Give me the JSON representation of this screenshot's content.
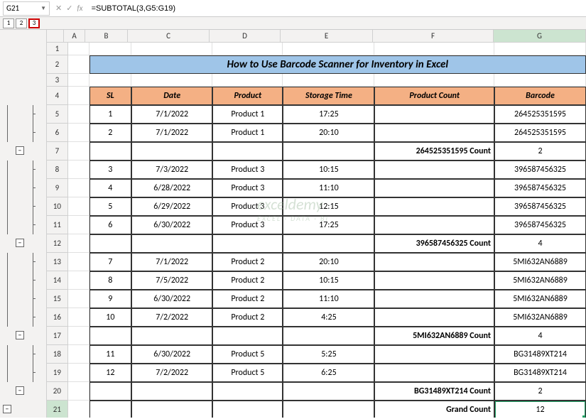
{
  "nameBox": "G21",
  "formula": "=SUBTOTAL(3,G5:G19)",
  "outlineLevels": [
    "1",
    "2",
    "3"
  ],
  "outlineSelected": "3",
  "colHeaders": [
    "A",
    "B",
    "C",
    "D",
    "E",
    "F",
    "G"
  ],
  "title": "How to Use Barcode Scanner for Inventory in Excel",
  "headers": {
    "sl": "SL",
    "date": "Date",
    "product": "Product",
    "storage": "Storage Time",
    "count": "Product Count",
    "barcode": "Barcode"
  },
  "rows": [
    {
      "num": 1,
      "low": true,
      "cells": [
        "",
        "",
        "",
        "",
        "",
        ""
      ]
    },
    {
      "num": 2,
      "title": true
    },
    {
      "num": 3,
      "low": true,
      "cells": [
        "",
        "",
        "",
        "",
        "",
        ""
      ]
    },
    {
      "num": 4,
      "header": true
    },
    {
      "num": 5,
      "ol": {
        "line": 2,
        "dot": true
      },
      "data": [
        "1",
        "7/1/2022",
        "Product 1",
        "17:25",
        "",
        "264525351595"
      ]
    },
    {
      "num": 6,
      "ol": {
        "line": 2,
        "dot": true
      },
      "data": [
        "2",
        "7/1/2022",
        "Product 1",
        "20:10",
        "",
        "264525351595"
      ]
    },
    {
      "num": 7,
      "ol": {
        "toggle": 1
      },
      "data": [
        "",
        "",
        "",
        "",
        "264525351595 Count",
        "2"
      ],
      "countRow": true
    },
    {
      "num": 8,
      "ol": {
        "line": 2,
        "dot": true
      },
      "data": [
        "3",
        "7/3/2022",
        "Product 3",
        "10:15",
        "",
        "396587456325"
      ]
    },
    {
      "num": 9,
      "ol": {
        "line": 2,
        "dot": true
      },
      "data": [
        "4",
        "6/28/2022",
        "Product 3",
        "11:10",
        "",
        "396587456325"
      ]
    },
    {
      "num": 10,
      "ol": {
        "line": 2,
        "dot": true
      },
      "data": [
        "5",
        "6/29/2022",
        "Product 3",
        "12:15",
        "",
        "396587456325"
      ]
    },
    {
      "num": 11,
      "ol": {
        "line": 2,
        "dot": true
      },
      "data": [
        "6",
        "6/30/2022",
        "Product 3",
        "17:25",
        "",
        "396587456325"
      ]
    },
    {
      "num": 12,
      "ol": {
        "toggle": 1
      },
      "data": [
        "",
        "",
        "",
        "",
        "396587456325 Count",
        "4"
      ],
      "countRow": true
    },
    {
      "num": 13,
      "ol": {
        "line": 2,
        "dot": true
      },
      "data": [
        "7",
        "7/1/2022",
        "Product 2",
        "20:10",
        "",
        "5MI632AN6889"
      ]
    },
    {
      "num": 14,
      "ol": {
        "line": 2,
        "dot": true
      },
      "data": [
        "8",
        "7/5/2022",
        "Product 2",
        "10:15",
        "",
        "5MI632AN6889"
      ]
    },
    {
      "num": 15,
      "ol": {
        "line": 2,
        "dot": true
      },
      "data": [
        "9",
        "6/30/2022",
        "Product 2",
        "11:10",
        "",
        "5MI632AN6889"
      ]
    },
    {
      "num": 16,
      "ol": {
        "line": 2,
        "dot": true
      },
      "data": [
        "10",
        "7/2/2022",
        "Product 2",
        "4:25",
        "",
        "5MI632AN6889"
      ]
    },
    {
      "num": 17,
      "ol": {
        "toggle": 1
      },
      "data": [
        "",
        "",
        "",
        "",
        "5MI632AN6889 Count",
        "4"
      ],
      "countRow": true
    },
    {
      "num": 18,
      "ol": {
        "line": 2,
        "dot": true
      },
      "data": [
        "11",
        "6/30/2022",
        "Product 5",
        "5:25",
        "",
        "BG31489XT214"
      ]
    },
    {
      "num": 19,
      "ol": {
        "line": 2,
        "dot": true
      },
      "data": [
        "12",
        "7/2/2022",
        "Product 5",
        "6:25",
        "",
        "BG31489XT214"
      ]
    },
    {
      "num": 20,
      "ol": {
        "toggle": 1
      },
      "data": [
        "",
        "",
        "",
        "",
        "BG31489XT214 Count",
        "2"
      ],
      "countRow": true
    },
    {
      "num": 21,
      "ol": {
        "toggle": 0
      },
      "data": [
        "",
        "",
        "",
        "",
        "Grand Count",
        "12"
      ],
      "countRow": true,
      "selected": true
    }
  ],
  "watermark": {
    "main": "exceldemy",
    "sub": "EXCEL · DATA · BI"
  },
  "chart_data": {
    "type": "table",
    "title": "How to Use Barcode Scanner for Inventory in Excel",
    "columns": [
      "SL",
      "Date",
      "Product",
      "Storage Time",
      "Product Count",
      "Barcode"
    ],
    "records": [
      {
        "SL": 1,
        "Date": "7/1/2022",
        "Product": "Product 1",
        "Storage Time": "17:25",
        "Barcode": "264525351595"
      },
      {
        "SL": 2,
        "Date": "7/1/2022",
        "Product": "Product 1",
        "Storage Time": "20:10",
        "Barcode": "264525351595"
      },
      {
        "SL": 3,
        "Date": "7/3/2022",
        "Product": "Product 3",
        "Storage Time": "10:15",
        "Barcode": "396587456325"
      },
      {
        "SL": 4,
        "Date": "6/28/2022",
        "Product": "Product 3",
        "Storage Time": "11:10",
        "Barcode": "396587456325"
      },
      {
        "SL": 5,
        "Date": "6/29/2022",
        "Product": "Product 3",
        "Storage Time": "12:15",
        "Barcode": "396587456325"
      },
      {
        "SL": 6,
        "Date": "6/30/2022",
        "Product": "Product 3",
        "Storage Time": "17:25",
        "Barcode": "396587456325"
      },
      {
        "SL": 7,
        "Date": "7/1/2022",
        "Product": "Product 2",
        "Storage Time": "20:10",
        "Barcode": "5MI632AN6889"
      },
      {
        "SL": 8,
        "Date": "7/5/2022",
        "Product": "Product 2",
        "Storage Time": "10:15",
        "Barcode": "5MI632AN6889"
      },
      {
        "SL": 9,
        "Date": "6/30/2022",
        "Product": "Product 2",
        "Storage Time": "11:10",
        "Barcode": "5MI632AN6889"
      },
      {
        "SL": 10,
        "Date": "7/2/2022",
        "Product": "Product 2",
        "Storage Time": "4:25",
        "Barcode": "5MI632AN6889"
      },
      {
        "SL": 11,
        "Date": "6/30/2022",
        "Product": "Product 5",
        "Storage Time": "5:25",
        "Barcode": "BG31489XT214"
      },
      {
        "SL": 12,
        "Date": "7/2/2022",
        "Product": "Product 5",
        "Storage Time": "6:25",
        "Barcode": "BG31489XT214"
      }
    ],
    "subtotals": [
      {
        "label": "264525351595 Count",
        "value": 2
      },
      {
        "label": "396587456325 Count",
        "value": 4
      },
      {
        "label": "5MI632AN6889 Count",
        "value": 4
      },
      {
        "label": "BG31489XT214 Count",
        "value": 2
      },
      {
        "label": "Grand Count",
        "value": 12
      }
    ]
  }
}
